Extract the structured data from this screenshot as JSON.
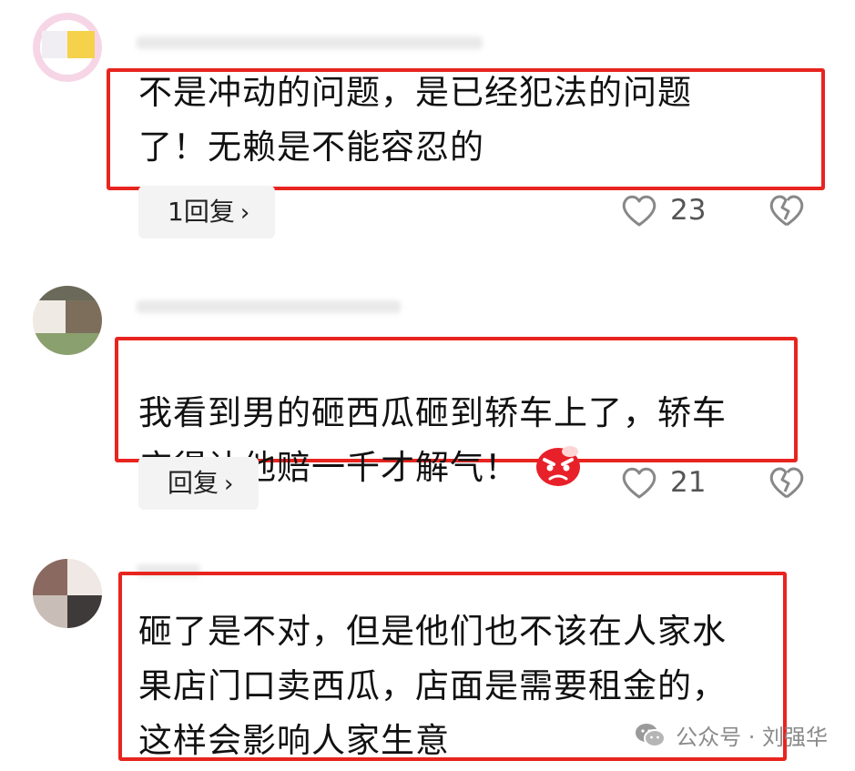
{
  "comments": [
    {
      "text": "不是冲动的问题，是已经犯法的问题\n了！无赖是不能容忍的",
      "reply_label": "1回复",
      "likes": "23"
    },
    {
      "text": "我看到男的砸西瓜砸到轿车上了，轿车\n应得让他赔一千才解气！",
      "emoji": "angry-face-emoji",
      "reply_label": "回复",
      "likes": "21"
    },
    {
      "text": "砸了是不对，但是他们也不该在人家水\n果店门口卖西瓜，店面是需要租金的，\n这样会影响人家生意"
    }
  ],
  "watermark": {
    "icon": "wechat-icon",
    "text": "公众号 · 刘强华"
  },
  "colors": {
    "highlight_border": "#e8241f",
    "reply_chip_bg": "#f3f3f3",
    "muted_text": "#555555"
  }
}
